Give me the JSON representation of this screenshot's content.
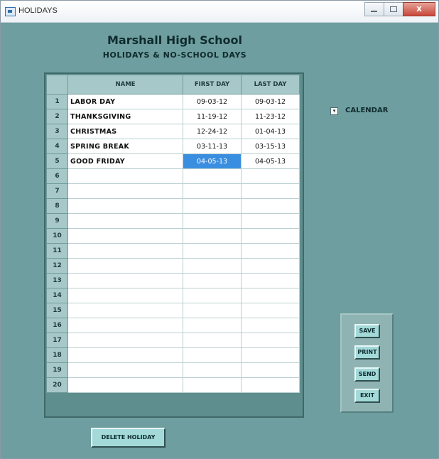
{
  "window": {
    "title": "HOLIDAYS",
    "close_glyph": "x",
    "icons": [
      "app-icon",
      "minimize-icon",
      "maximize-icon",
      "close-icon"
    ]
  },
  "header": {
    "school_name": "Marshall High School",
    "subtitle": "HOLIDAYS & NO-SCHOOL DAYS"
  },
  "grid": {
    "columns": [
      "",
      "NAME",
      "FIRST DAY",
      "LAST DAY"
    ],
    "selected_cell": {
      "row": 5,
      "column": "FIRST DAY"
    },
    "rows": [
      {
        "num": "1",
        "name": "LABOR DAY",
        "first": "09-03-12",
        "last": "09-03-12"
      },
      {
        "num": "2",
        "name": "THANKSGIVING",
        "first": "11-19-12",
        "last": "11-23-12"
      },
      {
        "num": "3",
        "name": "CHRISTMAS",
        "first": "12-24-12",
        "last": "01-04-13"
      },
      {
        "num": "4",
        "name": "SPRING BREAK",
        "first": "03-11-13",
        "last": "03-15-13"
      },
      {
        "num": "5",
        "name": "GOOD FRIDAY",
        "first": "04-05-13",
        "last": "04-05-13"
      },
      {
        "num": "6",
        "name": "",
        "first": "",
        "last": ""
      },
      {
        "num": "7",
        "name": "",
        "first": "",
        "last": ""
      },
      {
        "num": "8",
        "name": "",
        "first": "",
        "last": ""
      },
      {
        "num": "9",
        "name": "",
        "first": "",
        "last": ""
      },
      {
        "num": "10",
        "name": "",
        "first": "",
        "last": ""
      },
      {
        "num": "11",
        "name": "",
        "first": "",
        "last": ""
      },
      {
        "num": "12",
        "name": "",
        "first": "",
        "last": ""
      },
      {
        "num": "13",
        "name": "",
        "first": "",
        "last": ""
      },
      {
        "num": "14",
        "name": "",
        "first": "",
        "last": ""
      },
      {
        "num": "15",
        "name": "",
        "first": "",
        "last": ""
      },
      {
        "num": "16",
        "name": "",
        "first": "",
        "last": ""
      },
      {
        "num": "17",
        "name": "",
        "first": "",
        "last": ""
      },
      {
        "num": "18",
        "name": "",
        "first": "",
        "last": ""
      },
      {
        "num": "19",
        "name": "",
        "first": "",
        "last": ""
      },
      {
        "num": "20",
        "name": "",
        "first": "",
        "last": ""
      }
    ]
  },
  "calendar": {
    "label": "CALENDAR",
    "toggle_glyph": "▾",
    "icon": "dropdown-arrow-icon"
  },
  "actions": {
    "save": "SAVE",
    "print": "PRINT",
    "send": "SEND",
    "exit": "EXIT",
    "delete": "DELETE HOLIDAY"
  },
  "colors": {
    "window_bg": "#6e9e9f",
    "header_cells": "#a7c8c8",
    "selection": "#3a8ee0",
    "button_face": "#a4d9d9",
    "close_button": "#c7483a"
  }
}
